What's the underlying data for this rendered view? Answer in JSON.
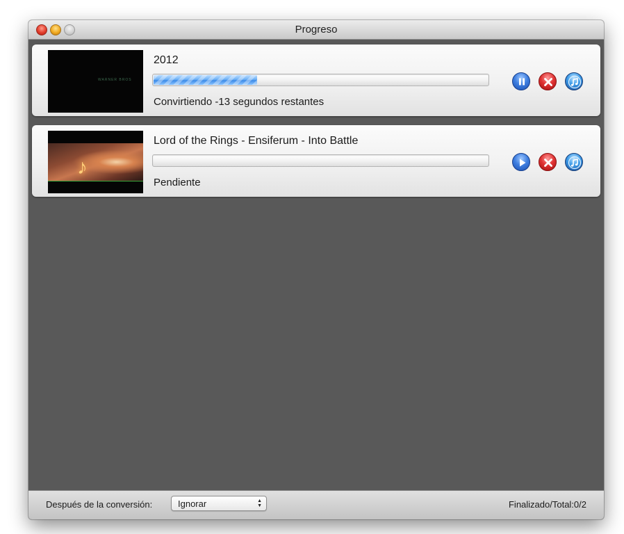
{
  "window": {
    "title": "Progreso"
  },
  "items": [
    {
      "title": "2012",
      "status": "Convirtiendo -13 segundos restantes",
      "progress_fraction": 0.31,
      "thumbnail_text": "WARNER BROS",
      "controls": [
        "pause-icon",
        "cancel-icon",
        "itunes-icon"
      ]
    },
    {
      "title": "Lord of the Rings - Ensiferum - Into Battle",
      "status": "Pendiente",
      "progress_fraction": 0,
      "controls": [
        "play-icon",
        "cancel-icon",
        "itunes-icon"
      ]
    }
  ],
  "footer": {
    "after_conversion_label": "Después de la conversión:",
    "after_conversion_value": "Ignorar",
    "total_label": "Finalizado/Total:0/2"
  },
  "colors": {
    "window_background": "#595959",
    "progress_fill": "#3d8be8",
    "cancel_red": "#e03434",
    "accent_blue": "#3f7fe0"
  }
}
